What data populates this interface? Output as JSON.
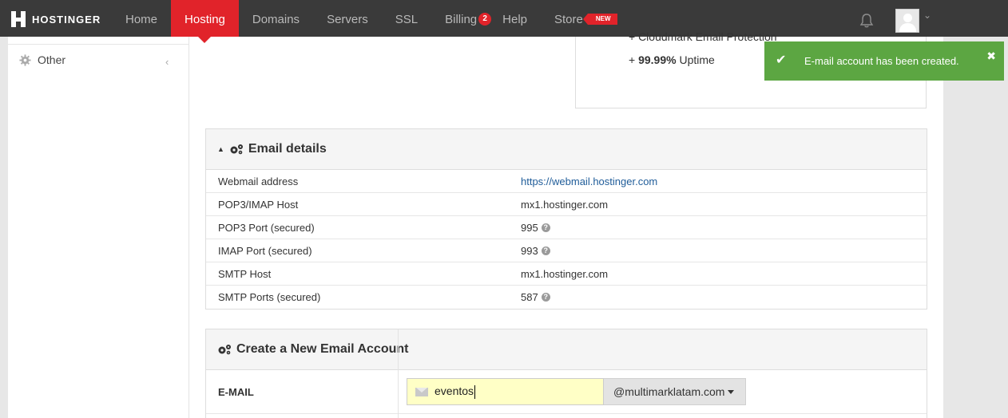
{
  "brand": "HOSTINGER",
  "nav": {
    "home": "Home",
    "hosting": "Hosting",
    "domains": "Domains",
    "servers": "Servers",
    "ssl": "SSL",
    "billing": "Billing",
    "billing_badge": "2",
    "help": "Help",
    "store": "Store",
    "store_tag": "NEW"
  },
  "sidebar": {
    "other_label": "Other"
  },
  "plan": {
    "cut_line": "+ Cloudmark Email Protection",
    "uptime_value": "99.99%",
    "uptime_label": "Uptime"
  },
  "email_details": {
    "title": "Email details",
    "rows": [
      {
        "key": "Webmail address",
        "value": "https://webmail.hostinger.com"
      },
      {
        "key": "POP3/IMAP Host",
        "value": "mx1.hostinger.com"
      },
      {
        "key": "POP3 Port (secured)",
        "value": "995"
      },
      {
        "key": "IMAP Port (secured)",
        "value": "993"
      },
      {
        "key": "SMTP Host",
        "value": "mx1.hostinger.com"
      },
      {
        "key": "SMTP Ports (secured)",
        "value": "587"
      }
    ]
  },
  "create_account": {
    "title": "Create a New Email Account",
    "email_label": "E-MAIL",
    "email_value": "eventos",
    "domain": "@multimarklatam.com"
  },
  "toast": {
    "message": "E-mail account has been created.",
    "close": "✖",
    "check": "✔"
  },
  "colors": {
    "accent": "#e1232a",
    "success": "#5ca642",
    "topbar": "#3a3a3a"
  }
}
